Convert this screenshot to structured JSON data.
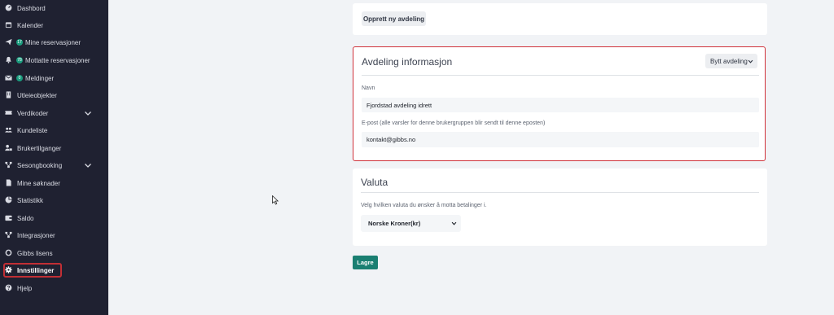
{
  "sidebar": {
    "items": [
      {
        "label": "Dashbord",
        "icon": "dashboard-icon",
        "top": 0
      },
      {
        "label": "Kalender",
        "icon": "calendar-icon"
      },
      {
        "label": "Mine reservasjoner",
        "icon": "paper-plane-icon",
        "badge": "17"
      },
      {
        "label": "Mottatte reservasjoner",
        "icon": "bell-icon",
        "badge": "78"
      },
      {
        "label": "Meldinger",
        "icon": "envelope-icon",
        "badge": "0"
      },
      {
        "label": "Utleieobjekter",
        "icon": "building-icon"
      },
      {
        "label": "Verdikoder",
        "icon": "ticket-icon",
        "chevron": true
      },
      {
        "label": "Kundeliste",
        "icon": "users-icon"
      },
      {
        "label": "Brukertilganger",
        "icon": "user-lock-icon"
      },
      {
        "label": "Sesongbooking",
        "icon": "sitemap-icon",
        "chevron": true
      },
      {
        "label": "Mine søknader",
        "icon": "file-icon"
      },
      {
        "label": "Statistikk",
        "icon": "pie-chart-icon"
      },
      {
        "label": "Saldo",
        "icon": "wallet-icon"
      },
      {
        "label": "Integrasjoner",
        "icon": "network-icon"
      },
      {
        "label": "Gibbs lisens",
        "icon": "cubes-icon"
      },
      {
        "label": "Innstillinger",
        "icon": "gear-icon",
        "active": true
      },
      {
        "label": "Hjelp",
        "icon": "question-icon"
      }
    ]
  },
  "top_card": {
    "create_button": "Opprett ny avdeling"
  },
  "department_info": {
    "title": "Avdeling informasjon",
    "switch_button": "Bytt avdeling",
    "name_label": "Navn",
    "name_value": "Fjordstad avdeling idrett",
    "email_label": "E-post (alle varsler for denne brukergruppen blir sendt til denne eposten)",
    "email_value": "kontakt@gibbs.no"
  },
  "currency": {
    "title": "Valuta",
    "description": "Velg hvilken valuta du ønsker å motta betalinger i.",
    "selected": "Norske Kroner(kr)"
  },
  "save_button": "Lagre",
  "colors": {
    "sidebar_bg": "#1f2131",
    "accent": "#1a7f72",
    "highlight": "#c22f35",
    "badge": "#1a9b7d"
  }
}
